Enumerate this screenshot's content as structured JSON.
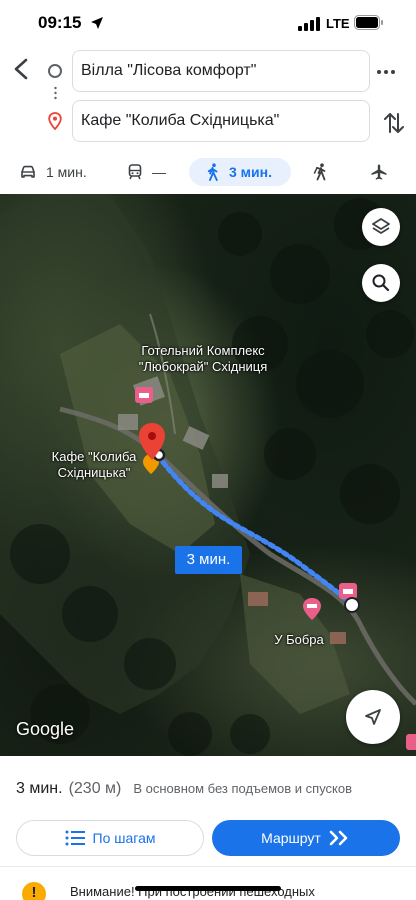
{
  "status_bar": {
    "time": "09:15",
    "network": "LTE"
  },
  "route": {
    "origin": "Вілла \"Лісова комфорт\"",
    "destination": "Кафе \"Колиба Східницька\""
  },
  "modes": {
    "car": "1 мин.",
    "transit": "—",
    "walk": "3 мин."
  },
  "map": {
    "hotel_label_line1": "Готельний Комплекс",
    "hotel_label_line2": "\"Любокрай\" Східниця",
    "cafe_label_line1": "Кафе \"Колиба",
    "cafe_label_line2": "Східницька\"",
    "place_label": "У Бобра",
    "duration_chip": "3 мин.",
    "attribution": "Google"
  },
  "summary": {
    "time": "3 мин.",
    "distance": "(230 м)",
    "note": "В основном без подъемов и спусков"
  },
  "actions": {
    "steps": "По шагам",
    "route": "Маршрут"
  },
  "warning": {
    "text": "Внимание! При построении пешеходных"
  },
  "colors": {
    "accent": "#1a73e8",
    "warning": "#f9ab00",
    "pin": "#ea4335"
  },
  "icons": [
    "back-arrow-icon",
    "origin-circle-icon",
    "destination-pin-icon",
    "more-icon",
    "swap-icon",
    "car-icon",
    "transit-icon",
    "walk-icon",
    "ride-icon",
    "flight-icon",
    "layers-icon",
    "search-icon",
    "locate-icon",
    "steps-list-icon",
    "route-arrows-icon",
    "warning-icon"
  ]
}
